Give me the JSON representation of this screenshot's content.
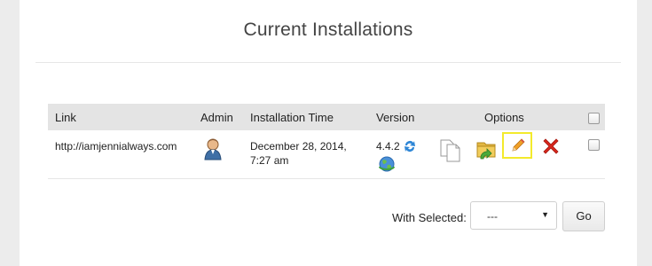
{
  "title": "Current Installations",
  "table": {
    "headers": {
      "link": "Link",
      "admin": "Admin",
      "installation_time": "Installation Time",
      "version": "Version",
      "options": "Options"
    },
    "rows": [
      {
        "link": "http://iamjennialways.com",
        "time_line1": "December 28, 2014,",
        "time_line2": "7:27 am",
        "version": "4.4.2"
      }
    ]
  },
  "bulk": {
    "label": "With Selected:",
    "selected": "---",
    "go_label": "Go"
  },
  "icons": {
    "admin": "admin-user-icon",
    "upgrade": "refresh-icon",
    "staging": "globe-icon",
    "clone": "clone-icon",
    "backup": "backup-folder-icon",
    "edit": "pencil-edit-icon",
    "remove": "remove-x-icon"
  },
  "colors": {
    "header_bg": "#e4e4e4",
    "edit_highlight": "#f3ea2c",
    "remove_red": "#d9261c"
  }
}
